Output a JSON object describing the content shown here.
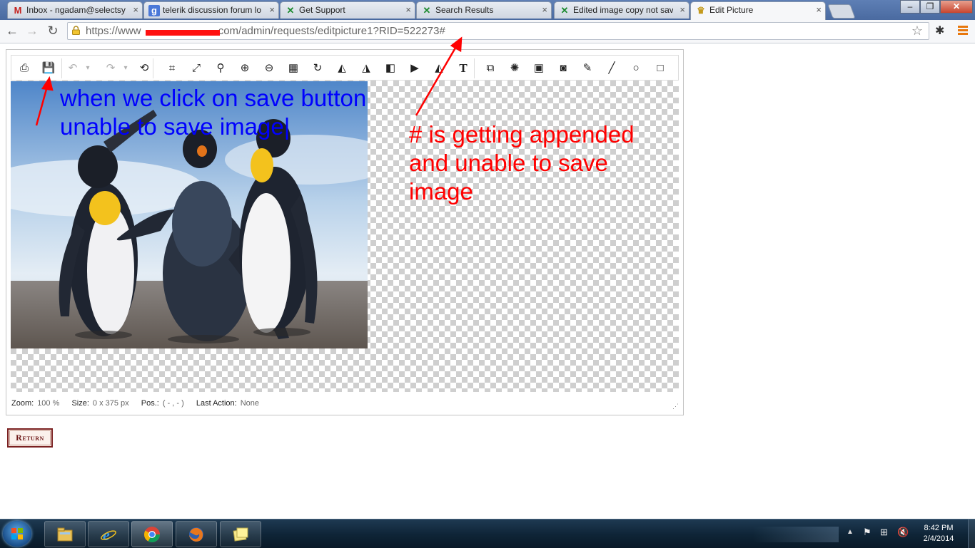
{
  "tabs": [
    {
      "label": "Inbox - ngadam@selectsy",
      "favicon": "gmail-icon",
      "active": false
    },
    {
      "label": "telerik discussion forum lo",
      "favicon": "google-icon",
      "active": false
    },
    {
      "label": "Get Support",
      "favicon": "telerik-icon",
      "active": false
    },
    {
      "label": "Search Results",
      "favicon": "telerik-icon",
      "active": false
    },
    {
      "label": "Edited image copy not sav",
      "favicon": "telerik-icon",
      "active": false
    },
    {
      "label": "Edit Picture",
      "favicon": "crown-icon",
      "active": true
    }
  ],
  "window": {
    "minimize": "–",
    "restore": "❐",
    "close": "✕"
  },
  "address_bar": {
    "url_prefix": "https://www",
    "url_suffix": ".com/admin/requests/editpicture1?RID=522273#"
  },
  "editor": {
    "toolbar": [
      {
        "name": "print-icon",
        "glyph": "⎙",
        "enabled": true
      },
      {
        "name": "save-icon",
        "glyph": "💾",
        "enabled": true
      },
      {
        "name": "undo-icon",
        "glyph": "↶",
        "enabled": false
      },
      {
        "name": "undo-dropdown-icon",
        "glyph": "▾",
        "enabled": false
      },
      {
        "name": "redo-icon",
        "glyph": "↷",
        "enabled": false
      },
      {
        "name": "redo-dropdown-icon",
        "glyph": "▾",
        "enabled": false
      },
      {
        "name": "reset-icon",
        "glyph": "⟲",
        "enabled": true
      },
      {
        "name": "crop-icon",
        "glyph": "⌗",
        "enabled": true
      },
      {
        "name": "resize-icon",
        "glyph": "⤢",
        "enabled": true
      },
      {
        "name": "zoom-icon",
        "glyph": "⚲",
        "enabled": true
      },
      {
        "name": "zoom-in-icon",
        "glyph": "⊕",
        "enabled": true
      },
      {
        "name": "zoom-out-icon",
        "glyph": "⊖",
        "enabled": true
      },
      {
        "name": "opacity-icon",
        "glyph": "▦",
        "enabled": true
      },
      {
        "name": "rotate-icon",
        "glyph": "↻",
        "enabled": true
      },
      {
        "name": "flip-icon",
        "glyph": "◭",
        "enabled": true
      },
      {
        "name": "flip-horizontal-icon",
        "glyph": "◮",
        "enabled": true
      },
      {
        "name": "flip-vertical-icon",
        "glyph": "◧",
        "enabled": true
      },
      {
        "name": "skew-icon",
        "glyph": "▶",
        "enabled": true
      },
      {
        "name": "pencil-icon",
        "glyph": "◭",
        "enabled": true
      },
      {
        "name": "text-icon",
        "glyph": "T",
        "enabled": true
      },
      {
        "name": "shapes-icon",
        "glyph": "⧉",
        "enabled": true
      },
      {
        "name": "effects-icon",
        "glyph": "✺",
        "enabled": true
      },
      {
        "name": "fill-icon",
        "glyph": "▣",
        "enabled": true
      },
      {
        "name": "gradient-icon",
        "glyph": "◙",
        "enabled": true
      },
      {
        "name": "brush-icon",
        "glyph": "✎",
        "enabled": true
      },
      {
        "name": "line-icon",
        "glyph": "╱",
        "enabled": true
      },
      {
        "name": "circle-icon",
        "glyph": "○",
        "enabled": true
      },
      {
        "name": "rectangle-icon",
        "glyph": "□",
        "enabled": true
      }
    ],
    "status": {
      "zoom_label": "Zoom:",
      "zoom_value": "100 %",
      "size_label": "Size:",
      "size_value": "0 x 375 px",
      "pos_label": "Pos.:",
      "pos_value": "( - , - )",
      "last_action_label": "Last Action:",
      "last_action_value": "None"
    }
  },
  "annotations": {
    "blue_line1": "when we click on save button",
    "blue_line2": "unable to save image|",
    "red_line1": "# is getting appended",
    "red_line2": "and unable to save",
    "red_line3": "image"
  },
  "return_button": "Return",
  "taskbar": {
    "clock_time": "8:42 PM",
    "clock_date": "2/4/2014",
    "pinned": [
      "explorer-icon",
      "ie-icon",
      "chrome-icon",
      "firefox-icon",
      "sticky-notes-icon"
    ]
  },
  "colors": {
    "annotation_blue": "#0000ff",
    "annotation_red": "#ff0000",
    "return_border": "#7a2020"
  }
}
